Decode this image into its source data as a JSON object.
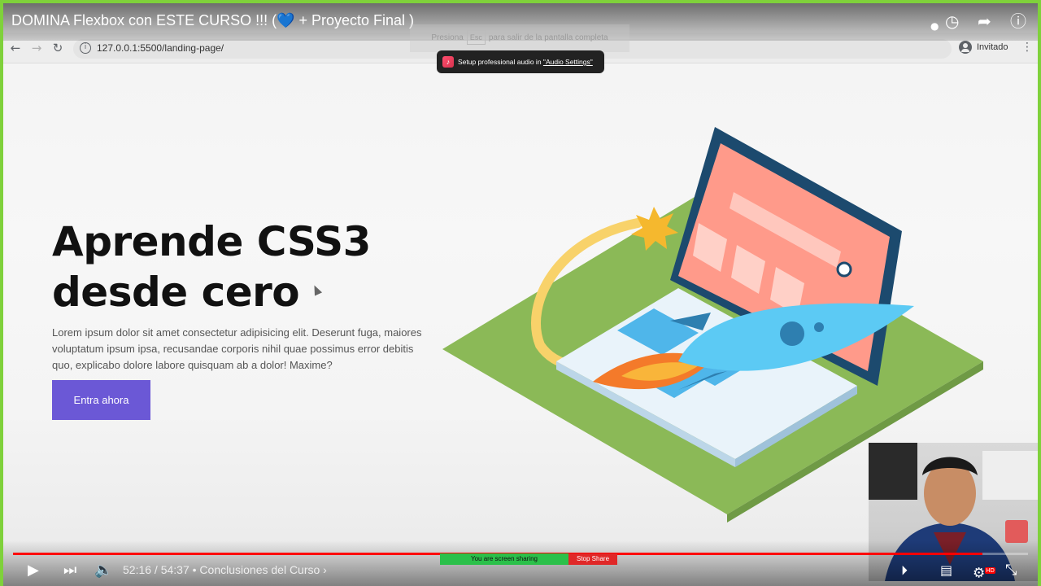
{
  "colors": {
    "border": "#7fd13b",
    "accent_button": "#6b58d6",
    "youtube_red": "#ff0000",
    "laptop_screen": "#ff9a8a",
    "laptop_frame": "#1c4a6e",
    "green_plate": "#8bb957",
    "rocket": "#5ccaf4"
  },
  "video": {
    "title": "DOMINA Flexbox con ESTE CURSO !!! (💙 + Proyecto Final )",
    "progress": 0.955
  },
  "browser": {
    "url": "127.0.0.1:5500/landing-page/",
    "profile_label": "Invitado",
    "icons": [
      "back-icon",
      "forward-icon",
      "reload-icon",
      "info-icon",
      "profile-icon",
      "menu-icon"
    ]
  },
  "fullscreen_hint": {
    "before": "Presiona",
    "key": "Esc",
    "after": "para salir de la pantalla completa"
  },
  "toast": {
    "text": "Setup professional audio in",
    "link": "\"Audio Settings\""
  },
  "hero": {
    "title_line1": "Aprende CSS3",
    "title_line2": "desde cero",
    "body": "Lorem ipsum dolor sit amet consectetur adipisicing elit. Deserunt fuga, maiores voluptatum ipsum ipsa, recusandae corporis nihil quae possimus error debitis quo, explicabo dolore labore quisquam ab a dolor! Maxime?",
    "cta": "Entra ahora"
  },
  "player": {
    "time": "52:16 / 54:37",
    "chapter": "• Conclusiones del Curso ›",
    "sharing_text": "You are screen sharing",
    "stop_share": "Stop Share",
    "hd_badge": "HD"
  }
}
